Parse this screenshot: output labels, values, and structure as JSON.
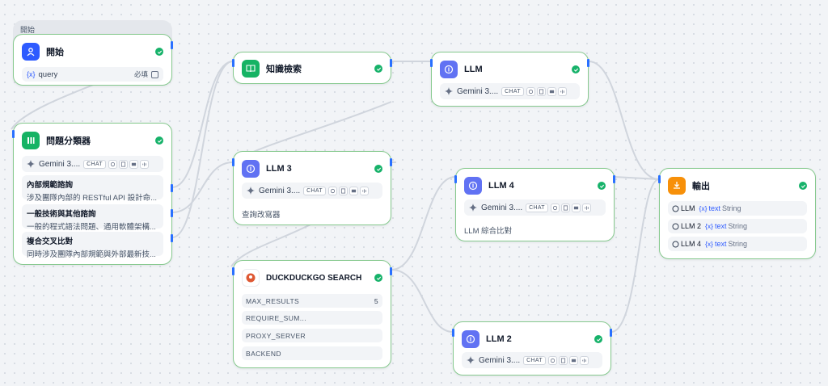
{
  "group": {
    "label": "開始"
  },
  "start": {
    "title": "開始",
    "var_icon": "{x}",
    "var_name": "query",
    "required": "必填"
  },
  "classifier": {
    "title": "問題分類器",
    "model": {
      "name": "Gemini 3....",
      "mode": "CHAT"
    },
    "classes": [
      {
        "title": "內部規範諮詢",
        "desc": "涉及團隊內部的 RESTful API 設計命..."
      },
      {
        "title": "一般技術與其他諮詢",
        "desc": "一般的程式語法問題、通用軟體架構..."
      },
      {
        "title": "複合交叉比對",
        "desc": "同時涉及團隊內部規範與外部最新技..."
      }
    ]
  },
  "knowledge": {
    "title": "知識檢索"
  },
  "llm": {
    "title": "LLM",
    "model": {
      "name": "Gemini 3....",
      "mode": "CHAT"
    }
  },
  "llm3": {
    "title": "LLM 3",
    "model": {
      "name": "Gemini 3....",
      "mode": "CHAT"
    },
    "desc": "查詢改寫器"
  },
  "llm4": {
    "title": "LLM 4",
    "model": {
      "name": "Gemini 3....",
      "mode": "CHAT"
    },
    "desc": "LLM 綜合比對"
  },
  "llm2": {
    "title": "LLM 2",
    "model": {
      "name": "Gemini 3....",
      "mode": "CHAT"
    }
  },
  "ddg": {
    "title": "DUCKDUCKGO SEARCH",
    "params": [
      {
        "name": "MAX_RESULTS",
        "value": "5"
      },
      {
        "name": "REQUIRE_SUM...",
        "value": ""
      },
      {
        "name": "PROXY_SERVER",
        "value": ""
      },
      {
        "name": "BACKEND",
        "value": ""
      }
    ]
  },
  "output": {
    "title": "輸出",
    "rows": [
      {
        "node": "LLM",
        "var_icon": "{x}",
        "var": "text",
        "type": "String"
      },
      {
        "node": "LLM 2",
        "var_icon": "{x}",
        "var": "text",
        "type": "String"
      },
      {
        "node": "LLM 4",
        "var_icon": "{x}",
        "var": "text",
        "type": "String"
      }
    ]
  },
  "colors": {
    "accent": "#2e5bff",
    "success": "#17b26a",
    "node_border": "#86c98e",
    "edge": "#d0d5dd"
  }
}
